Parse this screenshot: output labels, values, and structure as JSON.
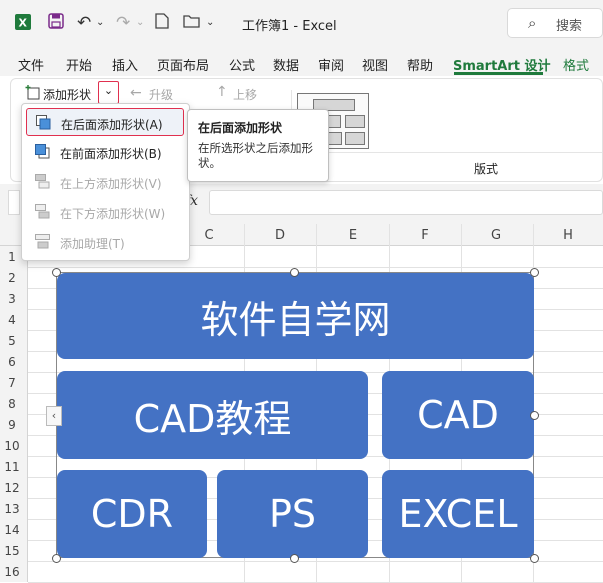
{
  "titlebar": {
    "app_icon": "excel-icon",
    "doc_title": "工作簿1  -  Excel",
    "search_placeholder": "搜索"
  },
  "menu": {
    "tabs": [
      "文件",
      "开始",
      "插入",
      "页面布局",
      "公式",
      "数据",
      "审阅",
      "视图",
      "帮助",
      "SmartArt 设计",
      "格式"
    ],
    "active_tab": "SmartArt 设计"
  },
  "ribbon": {
    "add_shape": "添加形状",
    "promote": "升级",
    "move_up": "上移",
    "layout_group": "版式"
  },
  "dropdown": {
    "items": [
      {
        "label": "在后面添加形状(A)",
        "enabled": true
      },
      {
        "label": "在前面添加形状(B)",
        "enabled": true
      },
      {
        "label": "在上方添加形状(V)",
        "enabled": false
      },
      {
        "label": "在下方添加形状(W)",
        "enabled": false
      },
      {
        "label": "添加助理(T)",
        "enabled": false
      }
    ]
  },
  "tooltip": {
    "title": "在后面添加形状",
    "body": "在所选形状之后添加形状。"
  },
  "formula": {
    "fx": "fx"
  },
  "grid": {
    "columns": [
      "C",
      "D",
      "E",
      "F",
      "G",
      "H"
    ],
    "rows": [
      "1",
      "2",
      "3",
      "4",
      "5",
      "6",
      "7",
      "8",
      "9",
      "10",
      "11",
      "12",
      "13",
      "14",
      "15",
      "16"
    ]
  },
  "smartart": {
    "top": "软件自学网",
    "row2": [
      "CAD教程",
      "CAD"
    ],
    "row3": [
      "CDR",
      "PS",
      "EXCEL"
    ],
    "shape_color": "#4472c4"
  },
  "colors": {
    "accent_green": "#1f7a3c",
    "highlight_red": "#e0304f"
  }
}
